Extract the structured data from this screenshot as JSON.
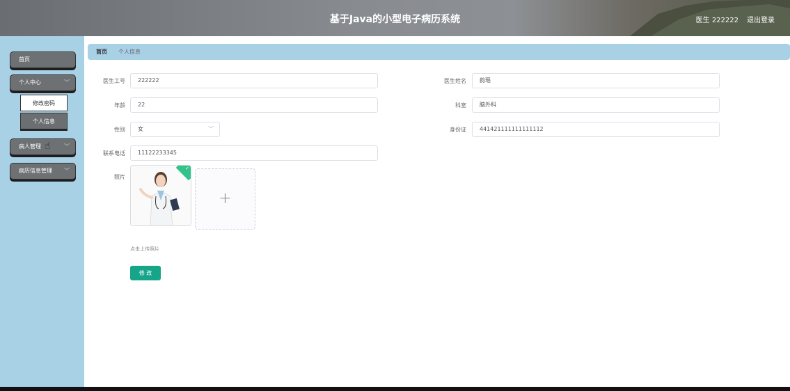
{
  "header": {
    "title": "基于Java的小型电子病历系统",
    "user": "医生 222222",
    "logout": "退出登录"
  },
  "sidebar": {
    "home": "首页",
    "personal_center": "个人中心",
    "change_password": "修改密码",
    "personal_info": "个人信息",
    "patient_mgmt": "病人管理",
    "record_mgmt": "病历信息管理"
  },
  "breadcrumb": {
    "home": "首页",
    "current": "个人信息"
  },
  "form": {
    "doctor_id_label": "医生工号",
    "doctor_id": "222222",
    "doctor_name_label": "医生姓名",
    "doctor_name": "韵瑶",
    "age_label": "年龄",
    "age": "22",
    "dept_label": "科室",
    "dept": "脑外科",
    "gender_label": "性别",
    "gender": "女",
    "idcard_label": "身份证",
    "idcard": "441421111111111112",
    "phone_label": "联系电话",
    "phone": "11122233345",
    "photo_label": "照片",
    "upload_plus": "+",
    "upload_hint": "点击上传照片",
    "submit": "修 改"
  },
  "colors": {
    "sidebar_bg": "#a8d1e6",
    "accent": "#17a589",
    "menu_btn": "#6e7173"
  }
}
